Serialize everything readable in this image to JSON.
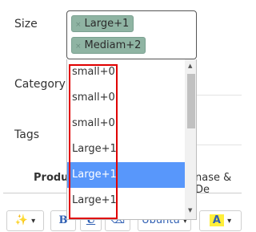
{
  "form": {
    "size_label": "Size",
    "category_label": "Category",
    "tags_label": "Tags"
  },
  "size_field": {
    "tags": [
      {
        "label": "Large+1",
        "remove": "×"
      },
      {
        "label": "Mediam+2",
        "remove": "×"
      }
    ]
  },
  "dropdown": {
    "options": [
      "small+0",
      "small+0",
      "small+0",
      "Large+1",
      "Large+1",
      "Large+1"
    ],
    "selected_index": 4
  },
  "tabs": {
    "product": "Produc",
    "purchase": "nase & De"
  },
  "toolbar": {
    "magic": "✨",
    "magic_caret": "▾",
    "bold": "B",
    "underline": "U",
    "eraser": "⌫",
    "font": "Ubuntu",
    "font_caret": "▾",
    "color": "A",
    "color_caret": "▾"
  }
}
